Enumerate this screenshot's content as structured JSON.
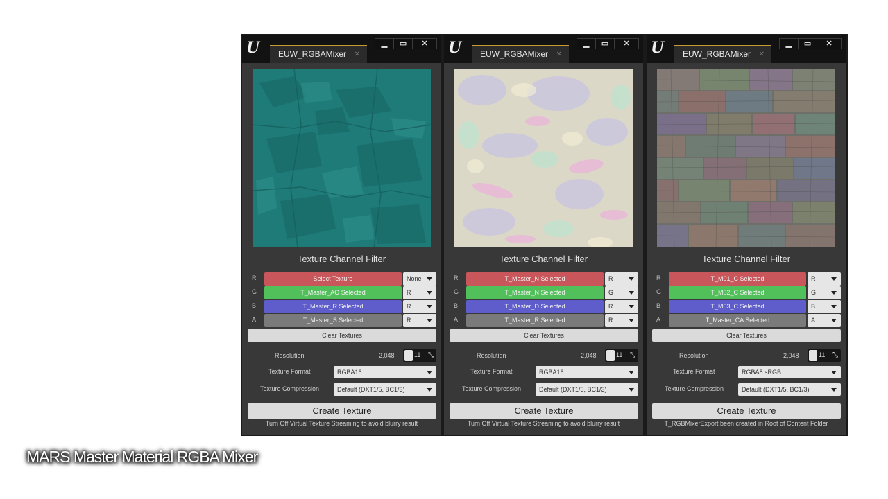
{
  "caption": "MARS Master Material RGBA Mixer",
  "labels": {
    "filter_title": "Texture Channel Filter",
    "clear": "Clear Textures",
    "resolution": "Resolution",
    "format": "Texture Format",
    "compression": "Texture Compression",
    "create": "Create Texture"
  },
  "channel_colors": {
    "R": "#c9565b",
    "G": "#52c05a",
    "B": "#5f5ccb",
    "A": "#7a7a7a"
  },
  "panels": [
    {
      "tab_title": "EUW_RGBAMixer",
      "preview": "teal ambient/roughness/specular packed texture",
      "channels": [
        {
          "label": "R",
          "texture": "Select Texture",
          "source": "None"
        },
        {
          "label": "G",
          "texture": "T_Master_AO Selected",
          "source": "R"
        },
        {
          "label": "B",
          "texture": "T_Master_R Selected",
          "source": "R"
        },
        {
          "label": "A",
          "texture": "T_Master_S Selected",
          "source": "R"
        }
      ],
      "resolution_value": "2,048",
      "resolution_power": "11",
      "format": "RGBA16",
      "compression": "Default (DXT1/5, BC1/3)",
      "footnote": "Turn Off Virtual Texture Streaming to avoid blurry result"
    },
    {
      "tab_title": "EUW_RGBAMixer",
      "preview": "rocky normal map texture",
      "channels": [
        {
          "label": "R",
          "texture": "T_Master_N Selected",
          "source": "R"
        },
        {
          "label": "G",
          "texture": "T_Master_N Selected",
          "source": "G"
        },
        {
          "label": "B",
          "texture": "T_Master_D Selected",
          "source": "R"
        },
        {
          "label": "A",
          "texture": "T_Master_R Selected",
          "source": "R"
        }
      ],
      "resolution_value": "2,048",
      "resolution_power": "11",
      "format": "RGBA16",
      "compression": "Default (DXT1/5, BC1/3)",
      "footnote": "Turn Off Virtual Texture Streaming to avoid blurry result"
    },
    {
      "tab_title": "EUW_RGBAMixer",
      "preview": "brick wall multicolor mix texture",
      "channels": [
        {
          "label": "R",
          "texture": "T_M01_C Selected",
          "source": "R"
        },
        {
          "label": "G",
          "texture": "T_M02_C Selected",
          "source": "G"
        },
        {
          "label": "B",
          "texture": "T_M03_C Selected",
          "source": "B"
        },
        {
          "label": "A",
          "texture": "T_Master_CA Selected",
          "source": "A"
        }
      ],
      "resolution_value": "2,048",
      "resolution_power": "11",
      "format": "RGBA8 sRGB",
      "compression": "Default (DXT1/5, BC1/3)",
      "footnote": "T_RGBMixerExport been created in Root of Content Folder"
    }
  ]
}
